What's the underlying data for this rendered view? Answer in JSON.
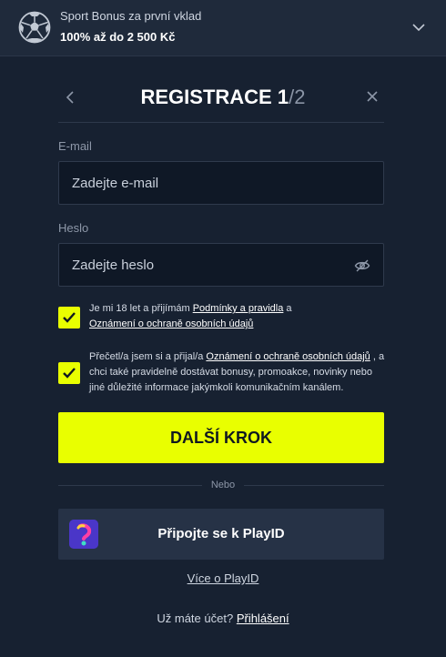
{
  "bonus": {
    "line1": "Sport Bonus za první vklad",
    "line2": "100% až do 2 500 Kč"
  },
  "header": {
    "title": "REGISTRACE",
    "step_current": "1",
    "step_separator": "/",
    "step_total": "2"
  },
  "email": {
    "label": "E-mail",
    "placeholder": "Zadejte e-mail",
    "value": ""
  },
  "password": {
    "label": "Heslo",
    "placeholder": "Zadejte heslo",
    "value": ""
  },
  "consent1": {
    "checked": true,
    "text_before": "Je mi 18 let a přijímám ",
    "link1": "Podmínky a pravidla",
    "text_mid": " a ",
    "link2": "Oznámení o ochraně osobních údajů"
  },
  "consent2": {
    "checked": true,
    "text_before": "Přečetl/a jsem si a přijal/a ",
    "link": "Oznámení o ochraně osobních údajů",
    "text_after": " , a chci také pravidelně dostávat bonusy, promoakce, novinky nebo jiné důležité informace jakýmkoli komunikačním kanálem."
  },
  "cta": {
    "label": "DALŠÍ KROK"
  },
  "divider": {
    "label": "Nebo"
  },
  "playid": {
    "button_label": "Připojte se k PlayID",
    "more_link": "Více o PlayID"
  },
  "login": {
    "question": "Už máte účet? ",
    "link": "Přihlášení"
  },
  "colors": {
    "background": "#172131",
    "accent": "#e9ff00",
    "field_bg": "#0f1826",
    "playid_button": "#263246"
  },
  "icons": {
    "bonus": "soccer-ball-icon",
    "expand": "chevron-down-icon",
    "back": "chevron-left-icon",
    "close": "close-icon",
    "password_toggle": "eye-off-icon",
    "checkbox": "checkmark-icon",
    "playid": "playid-logo-icon"
  }
}
